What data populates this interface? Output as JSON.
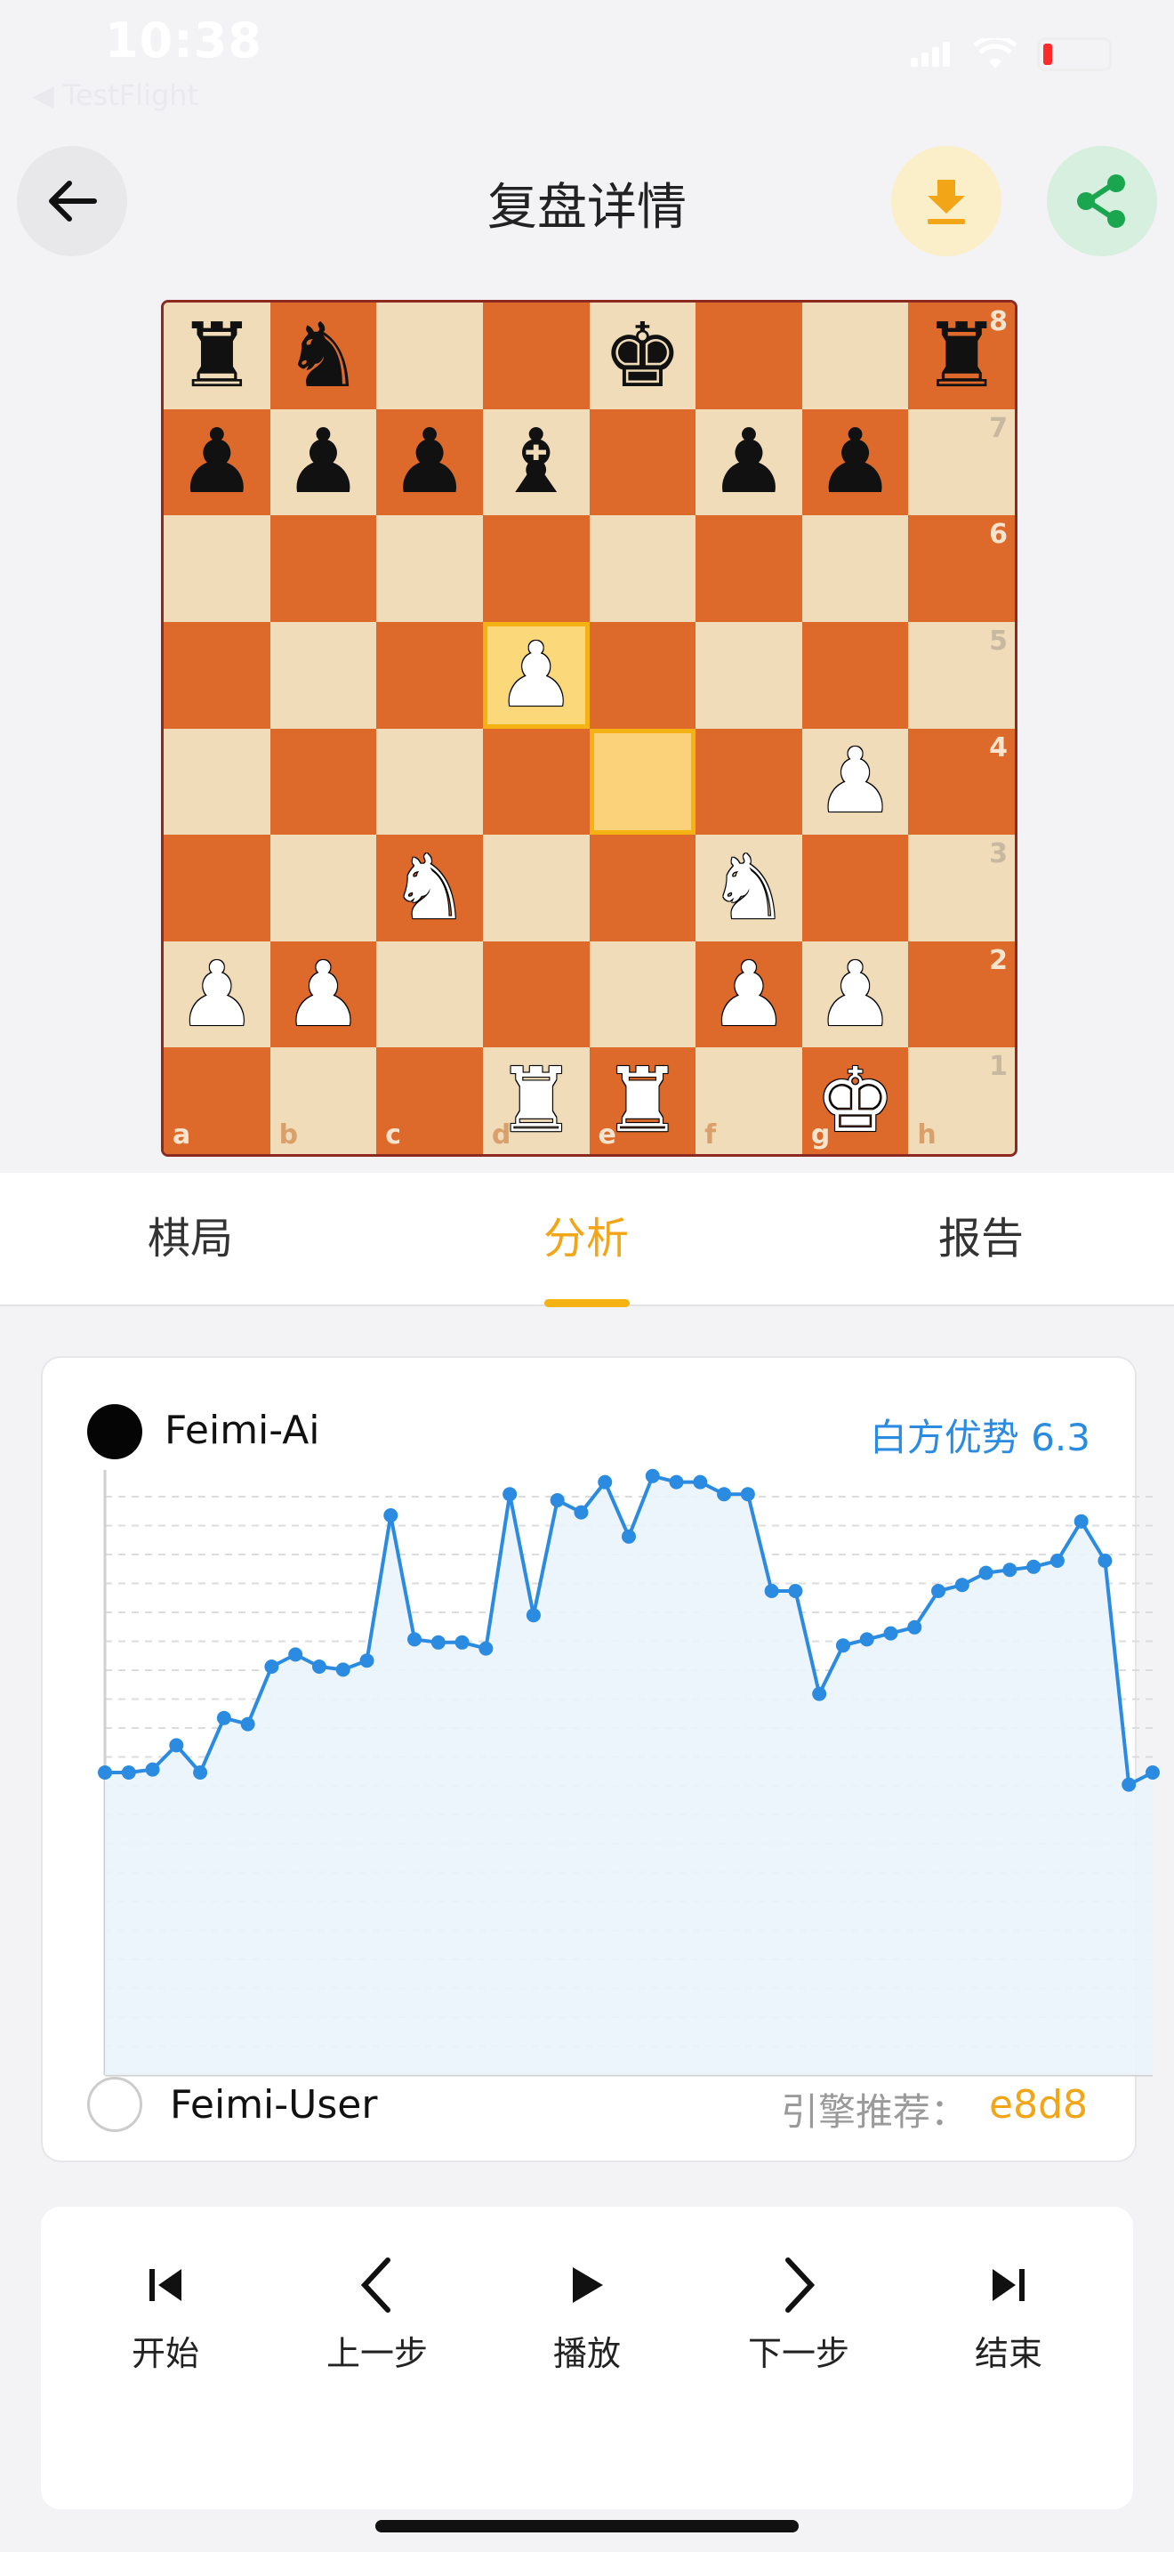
{
  "status_bar": {
    "time": "10:38",
    "back_app": "◀ TestFlight"
  },
  "header": {
    "title": "复盘详情",
    "back_icon": "arrow-left-icon",
    "download_icon": "download-icon",
    "share_icon": "share-icon"
  },
  "board": {
    "files": [
      "a",
      "b",
      "c",
      "d",
      "e",
      "f",
      "g",
      "h"
    ],
    "ranks": [
      "8",
      "7",
      "6",
      "5",
      "4",
      "3",
      "2",
      "1"
    ],
    "position": [
      [
        "br",
        "bn",
        "",
        "",
        "bk",
        "",
        "",
        "br"
      ],
      [
        "bp",
        "bp",
        "bp",
        "bb",
        "",
        "bp",
        "bp",
        ""
      ],
      [
        "",
        "",
        "",
        "",
        "",
        "",
        "",
        ""
      ],
      [
        "",
        "",
        "",
        "wp_hl",
        "",
        "",
        "",
        ""
      ],
      [
        "",
        "",
        "",
        "",
        "hl",
        "",
        "wp",
        ""
      ],
      [
        "",
        "",
        "wn",
        "",
        "",
        "wn",
        "",
        ""
      ],
      [
        "wp",
        "wp",
        "",
        "",
        "",
        "wp",
        "wp",
        ""
      ],
      [
        "",
        "",
        "",
        "wr",
        "wr",
        "",
        "wk",
        ""
      ]
    ],
    "highlight_from": "e4",
    "highlight_to": "d5"
  },
  "tabs": [
    {
      "label": "棋局",
      "active": false
    },
    {
      "label": "分析",
      "active": true
    },
    {
      "label": "报告",
      "active": false
    }
  ],
  "analysis": {
    "top_player": "Feimi-Ai",
    "advantage": "白方优势 6.3",
    "bottom_player": "Feimi-User",
    "recommend_label": "引擎推荐：",
    "recommend_move": "e8d8"
  },
  "chart_data": {
    "type": "line",
    "series": [
      {
        "values": [
          0.0,
          0.0,
          0.1,
          0.9,
          0.0,
          1.8,
          1.6,
          3.5,
          3.9,
          3.5,
          3.4,
          3.7,
          8.5,
          4.4,
          4.3,
          4.3,
          4.1,
          9.2,
          5.2,
          9.0,
          8.6,
          9.6,
          7.8,
          9.8,
          9.6,
          9.6,
          9.2,
          9.2,
          6.0,
          6.0,
          2.6,
          4.2,
          4.4,
          4.6,
          4.8,
          6.0,
          6.2,
          6.6,
          6.7,
          6.8,
          7.0,
          8.3,
          7.0,
          -0.4,
          0.0
        ]
      }
    ],
    "ylim": [
      -10,
      10
    ],
    "grid": true,
    "colors": {
      "line": "#2a8be0",
      "fill": "#eaf3fc"
    }
  },
  "controls": [
    {
      "label": "开始",
      "icon": "skip-start-icon"
    },
    {
      "label": "上一步",
      "icon": "chevron-left-icon"
    },
    {
      "label": "播放",
      "icon": "play-icon"
    },
    {
      "label": "下一步",
      "icon": "chevron-right-icon"
    },
    {
      "label": "结束",
      "icon": "skip-end-icon"
    }
  ]
}
